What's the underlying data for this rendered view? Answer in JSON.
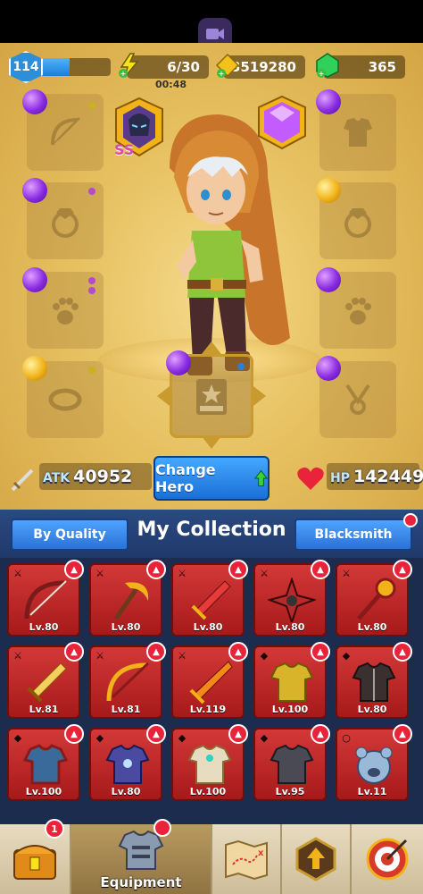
{
  "topbar": {
    "level": "114",
    "xp_progress": 0.45,
    "energy": "6/30",
    "energy_timer": "00:48",
    "gold": "3519280",
    "gems": "365"
  },
  "hero_stats": {
    "atk_label": "ATK",
    "atk_value": "40952",
    "hp_label": "HP",
    "hp_value": "142449",
    "change_hero_label": "Change Hero"
  },
  "skin_badge_text": "SS",
  "collection": {
    "by_quality_label": "By Quality",
    "title": "My Collection",
    "blacksmith_label": "Blacksmith",
    "items": [
      {
        "level": "Lv.80",
        "kind": "weapon",
        "art": "bow"
      },
      {
        "level": "Lv.80",
        "kind": "weapon",
        "art": "scythe"
      },
      {
        "level": "Lv.80",
        "kind": "weapon",
        "art": "sword"
      },
      {
        "level": "Lv.80",
        "kind": "weapon",
        "art": "shuriken"
      },
      {
        "level": "Lv.80",
        "kind": "weapon",
        "art": "staff"
      },
      {
        "level": "Lv.81",
        "kind": "weapon",
        "art": "sword-gold"
      },
      {
        "level": "Lv.81",
        "kind": "weapon",
        "art": "bow-gold"
      },
      {
        "level": "Lv.119",
        "kind": "weapon",
        "art": "sword-fire"
      },
      {
        "level": "Lv.100",
        "kind": "armor",
        "art": "armor-gold"
      },
      {
        "level": "Lv.80",
        "kind": "armor",
        "art": "robe-dark"
      },
      {
        "level": "Lv.100",
        "kind": "armor",
        "art": "vest-red"
      },
      {
        "level": "Lv.80",
        "kind": "armor",
        "art": "armor-purple"
      },
      {
        "level": "Lv.100",
        "kind": "armor",
        "art": "armor-white"
      },
      {
        "level": "Lv.95",
        "kind": "armor",
        "art": "armor-black"
      },
      {
        "level": "Lv.11",
        "kind": "ring",
        "art": "bear"
      }
    ]
  },
  "bottom_nav": {
    "chest_badge": "1",
    "equipment_label": "Equipment"
  },
  "colors": {
    "hero_bg": "#e7c161",
    "collection_bg": "#1b2c4f",
    "card_red": "#d43838",
    "accent_blue": "#2a72d6"
  }
}
